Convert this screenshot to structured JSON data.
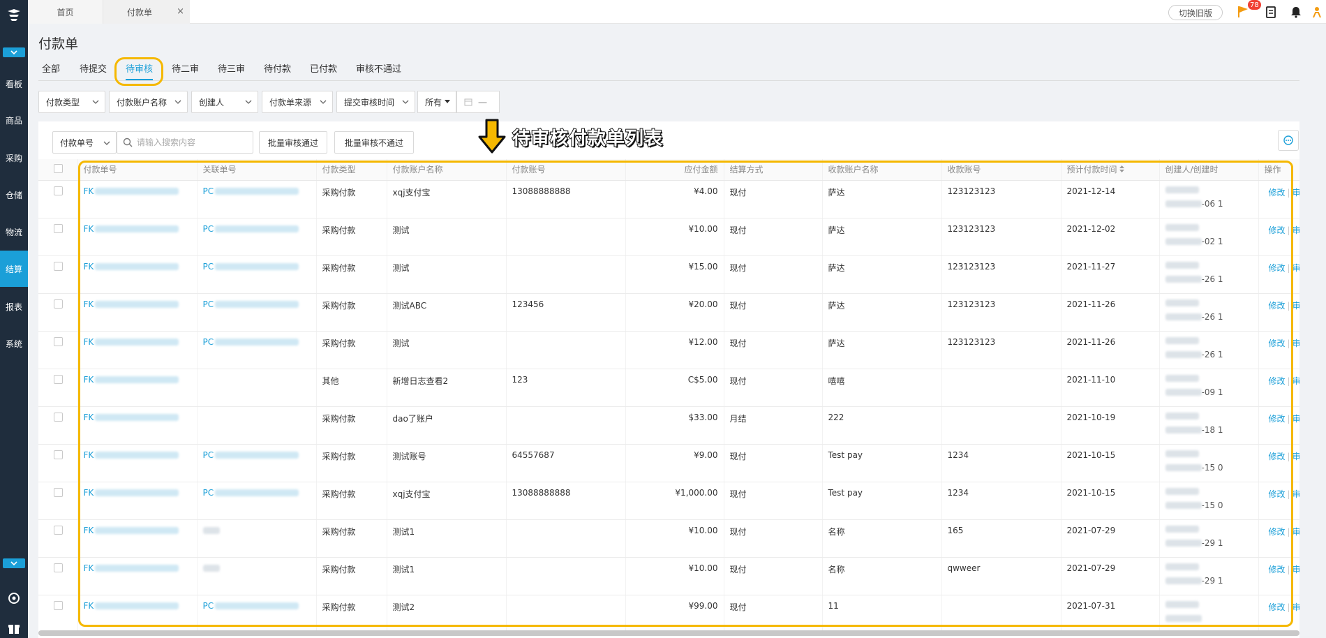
{
  "topbar": {
    "tabs": [
      {
        "label": "首页"
      },
      {
        "label": "付款单",
        "close": "×"
      }
    ],
    "switch_old": "切换旧版",
    "notification_count": "78"
  },
  "sidebar": {
    "items": [
      {
        "label": "看板"
      },
      {
        "label": "商品"
      },
      {
        "label": "采购"
      },
      {
        "label": "仓储"
      },
      {
        "label": "物流"
      },
      {
        "label": "结算",
        "active": true
      },
      {
        "label": "报表"
      },
      {
        "label": "系统"
      }
    ]
  },
  "page": {
    "title": "付款单"
  },
  "status_tabs": [
    {
      "label": "全部"
    },
    {
      "label": "待提交"
    },
    {
      "label": "待审核",
      "active": true
    },
    {
      "label": "待二审"
    },
    {
      "label": "待三审"
    },
    {
      "label": "待付款"
    },
    {
      "label": "已付款"
    },
    {
      "label": "审核不通过"
    }
  ],
  "filters": {
    "pay_type": "付款类型",
    "account_name": "付款账户名称",
    "creator": "创建人",
    "source": "付款单来源",
    "submit_time": "提交审核时间",
    "all": "所有",
    "date_dash": "一"
  },
  "toolbar": {
    "search_type": "付款单号",
    "search_placeholder": "请输入搜索内容",
    "batch_pass": "批量审核通过",
    "batch_reject": "批量审核不通过"
  },
  "annotation": {
    "text": "待审核付款单列表"
  },
  "table": {
    "columns": [
      "付款单号",
      "关联单号",
      "付款类型",
      "付款账户名称",
      "付款账号",
      "应付金额",
      "结算方式",
      "收款账户名称",
      "收款账号",
      "预计付款时间",
      "创建人/创建时",
      "操作"
    ],
    "op_edit": "修改",
    "op_detail": "审核详情",
    "rows": [
      {
        "no": "FK",
        "rel": "PC",
        "type": "采购付款",
        "acct_name": "xqj支付宝",
        "acct_no": "13088888888",
        "amount": "¥4.00",
        "settle": "现付",
        "payee": "萨达",
        "payee_no": "123123123",
        "date": "2021-12-14",
        "ct": "-06 1"
      },
      {
        "no": "FK",
        "rel": "PC",
        "type": "采购付款",
        "acct_name": "测试",
        "acct_no": "",
        "amount": "¥10.00",
        "settle": "现付",
        "payee": "萨达",
        "payee_no": "123123123",
        "date": "2021-12-02",
        "ct": "-02 1"
      },
      {
        "no": "FK",
        "rel": "PC",
        "type": "采购付款",
        "acct_name": "测试",
        "acct_no": "",
        "amount": "¥15.00",
        "settle": "现付",
        "payee": "萨达",
        "payee_no": "123123123",
        "date": "2021-11-27",
        "ct": "-26 1"
      },
      {
        "no": "FK",
        "rel": "PC",
        "type": "采购付款",
        "acct_name": "测试ABC",
        "acct_no": "123456",
        "amount": "¥20.00",
        "settle": "现付",
        "payee": "萨达",
        "payee_no": "123123123",
        "date": "2021-11-26",
        "ct": "-26 1"
      },
      {
        "no": "FK",
        "rel": "PC",
        "type": "采购付款",
        "acct_name": "测试",
        "acct_no": "",
        "amount": "¥12.00",
        "settle": "现付",
        "payee": "萨达",
        "payee_no": "123123123",
        "date": "2021-11-26",
        "ct": "-26 1"
      },
      {
        "no": "FK",
        "rel": "",
        "type": "其他",
        "acct_name": "新增日志查看2",
        "acct_no": "123",
        "amount": "C$5.00",
        "settle": "现付",
        "payee": "嘻嘻",
        "payee_no": "",
        "date": "2021-11-10",
        "ct": "-09 1"
      },
      {
        "no": "FK",
        "rel": "",
        "type": "采购付款",
        "acct_name": "dao了账户",
        "acct_no": "",
        "amount": "$33.00",
        "settle": "月结",
        "payee": "222",
        "payee_no": "",
        "date": "2021-10-19",
        "ct": "-18 1"
      },
      {
        "no": "FK",
        "rel": "PC",
        "type": "采购付款",
        "acct_name": "测试账号",
        "acct_no": "64557687",
        "amount": "¥9.00",
        "settle": "现付",
        "payee": "Test pay",
        "payee_no": "1234",
        "date": "2021-10-15",
        "ct": "-15 0"
      },
      {
        "no": "FK",
        "rel": "PC",
        "type": "采购付款",
        "acct_name": "xqj支付宝",
        "acct_no": "13088888888",
        "amount": "¥1,000.00",
        "settle": "现付",
        "payee": "Test pay",
        "payee_no": "1234",
        "date": "2021-10-15",
        "ct": "-15 0"
      },
      {
        "no": "FK",
        "rel": "grey",
        "type": "采购付款",
        "acct_name": "测试1",
        "acct_no": "",
        "amount": "¥10.00",
        "settle": "现付",
        "payee": "名称",
        "payee_no": "165",
        "date": "2021-07-29",
        "ct": "-29 1"
      },
      {
        "no": "FK",
        "rel": "grey",
        "type": "采购付款",
        "acct_name": "测试1",
        "acct_no": "",
        "amount": "¥10.00",
        "settle": "现付",
        "payee": "名称",
        "payee_no": "qwweer",
        "date": "2021-07-29",
        "ct": "-29 1"
      },
      {
        "no": "FK",
        "rel": "PC",
        "type": "采购付款",
        "acct_name": "测试2",
        "acct_no": "",
        "amount": "¥99.00",
        "settle": "现付",
        "payee": "11",
        "payee_no": "",
        "date": "2021-07-31",
        "ct": ""
      }
    ]
  },
  "colors": {
    "accent": "#1b9fd8",
    "sidebar": "#1f2d3d",
    "highlight": "#f5b800",
    "badge": "#f04134"
  }
}
